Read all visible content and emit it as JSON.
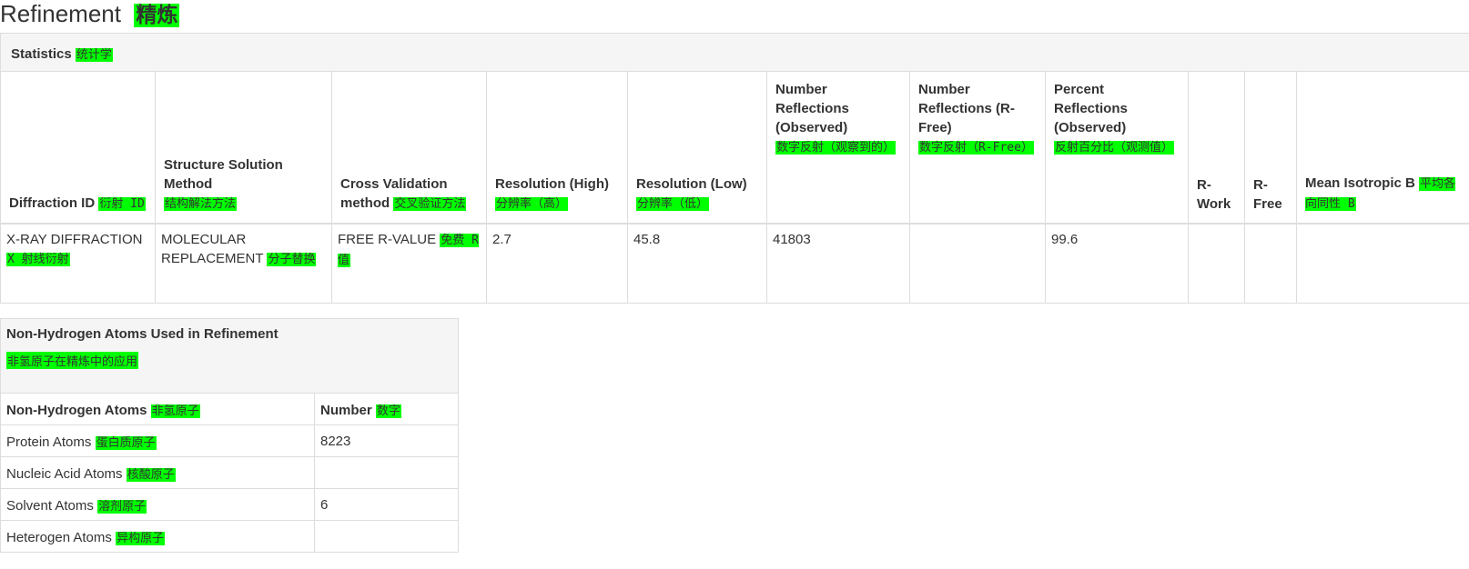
{
  "title": {
    "en": "Refinement",
    "zh": "精炼"
  },
  "statistics": {
    "header": {
      "en": "Statistics",
      "zh": "统计学"
    },
    "columns": [
      {
        "en": "Diffraction ID",
        "zh": "衍射 ID"
      },
      {
        "en": "Structure Solution Method",
        "zh": "结构解法方法"
      },
      {
        "en": "Cross Validation method",
        "zh": "交叉验证方法"
      },
      {
        "en": "Resolution (High)",
        "zh": "分辨率（高）"
      },
      {
        "en": "Resolution (Low)",
        "zh": "分辨率（低）"
      },
      {
        "en": "Number Reflections (Observed)",
        "zh": "数字反射（观察到的）"
      },
      {
        "en": "Number Reflections (R-Free)",
        "zh": "数字反射（R-Free）"
      },
      {
        "en": "Percent Reflections (Observed)",
        "zh": "反射百分比（观测值）"
      },
      {
        "en": "R-Work",
        "zh": ""
      },
      {
        "en": "R-Free",
        "zh": ""
      },
      {
        "en": "Mean Isotropic B",
        "zh": "平均各向同性 B"
      }
    ],
    "row": [
      {
        "en": "X-RAY DIFFRACTION",
        "zh": "X 射线衍射"
      },
      {
        "en": "MOLECULAR REPLACEMENT",
        "zh": "分子替换"
      },
      {
        "en": "FREE R-VALUE",
        "zh": "免费 R 值"
      },
      {
        "en": "2.7",
        "zh": ""
      },
      {
        "en": "45.8",
        "zh": ""
      },
      {
        "en": "41803",
        "zh": ""
      },
      {
        "en": "",
        "zh": ""
      },
      {
        "en": "99.6",
        "zh": ""
      },
      {
        "en": "",
        "zh": ""
      },
      {
        "en": "",
        "zh": ""
      },
      {
        "en": "",
        "zh": ""
      }
    ]
  },
  "non_hydrogen": {
    "caption": {
      "en": "Non-Hydrogen Atoms Used in Refinement",
      "zh": "非氢原子在精炼中的应用"
    },
    "headers": [
      {
        "en": "Non-Hydrogen Atoms",
        "zh": "非氢原子"
      },
      {
        "en": "Number",
        "zh": "数字"
      }
    ],
    "rows": [
      {
        "label": {
          "en": "Protein Atoms",
          "zh": "蛋白质原子"
        },
        "value": "8223"
      },
      {
        "label": {
          "en": "Nucleic Acid Atoms",
          "zh": "核酸原子"
        },
        "value": ""
      },
      {
        "label": {
          "en": "Solvent Atoms",
          "zh": "溶剂原子"
        },
        "value": "6"
      },
      {
        "label": {
          "en": "Heterogen Atoms",
          "zh": "异构原子"
        },
        "value": ""
      }
    ]
  },
  "colors": {
    "highlight": "#00ff00",
    "header_bg": "#f5f5f5",
    "border": "#dddddd",
    "text": "#333333"
  }
}
